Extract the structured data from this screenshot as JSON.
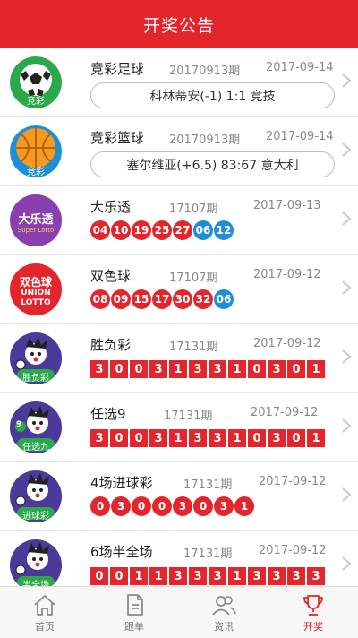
{
  "header": {
    "title": "开奖公告"
  },
  "lotteries": [
    {
      "name": "竞彩足球",
      "issue": "20170913期",
      "date": "2017-09-14",
      "logo_text": "竞彩",
      "kind": "match",
      "match": "科林蒂安(-1)  1:1  竞技"
    },
    {
      "name": "竞彩篮球",
      "issue": "20170913期",
      "date": "2017-09-14",
      "logo_text": "竞彩",
      "kind": "match",
      "match": "塞尔维亚(+6.5)  83:67  意大利"
    },
    {
      "name": "大乐透",
      "issue": "17107期",
      "date": "2017-09-13",
      "logo_text": "大乐透",
      "kind": "balls",
      "red": [
        "04",
        "10",
        "19",
        "25",
        "27"
      ],
      "blue": [
        "06",
        "12"
      ]
    },
    {
      "name": "双色球",
      "issue": "17107期",
      "date": "2017-09-12",
      "logo_text": "双色球",
      "kind": "balls",
      "red": [
        "08",
        "09",
        "15",
        "17",
        "30",
        "32"
      ],
      "blue": [
        "06"
      ]
    },
    {
      "name": "胜负彩",
      "issue": "17131期",
      "date": "2017-09-12",
      "logo_text": "胜负彩",
      "kind": "squares",
      "digits": [
        "3",
        "0",
        "0",
        "3",
        "1",
        "3",
        "3",
        "1",
        "0",
        "3",
        "0",
        "1"
      ]
    },
    {
      "name": "任选9",
      "issue": "17131期",
      "date": "2017-09-12",
      "logo_text": "任选九",
      "kind": "squares",
      "digits": [
        "3",
        "0",
        "0",
        "3",
        "1",
        "3",
        "3",
        "1",
        "0",
        "3",
        "0",
        "1"
      ]
    },
    {
      "name": "4场进球彩",
      "issue": "17131期",
      "date": "2017-09-12",
      "logo_text": "进球彩",
      "kind": "balls",
      "red": [
        "0",
        "3",
        "0",
        "0",
        "3",
        "0",
        "3",
        "1"
      ],
      "blue": []
    },
    {
      "name": "6场半全场",
      "issue": "17131期",
      "date": "2017-09-12",
      "logo_text": "半全场",
      "kind": "squares",
      "digits": [
        "0",
        "0",
        "1",
        "1",
        "3",
        "3",
        "3",
        "1",
        "3",
        "3",
        "3",
        "3"
      ]
    }
  ],
  "tabs": [
    {
      "label": "首页",
      "icon": "home-icon",
      "active": false
    },
    {
      "label": "跟单",
      "icon": "document-icon",
      "active": false
    },
    {
      "label": "资讯",
      "icon": "people-icon",
      "active": false
    },
    {
      "label": "开奖",
      "icon": "trophy-icon",
      "active": true
    }
  ],
  "colors": {
    "brand_red": "#e4262c",
    "ball_blue": "#1e8fd6"
  }
}
